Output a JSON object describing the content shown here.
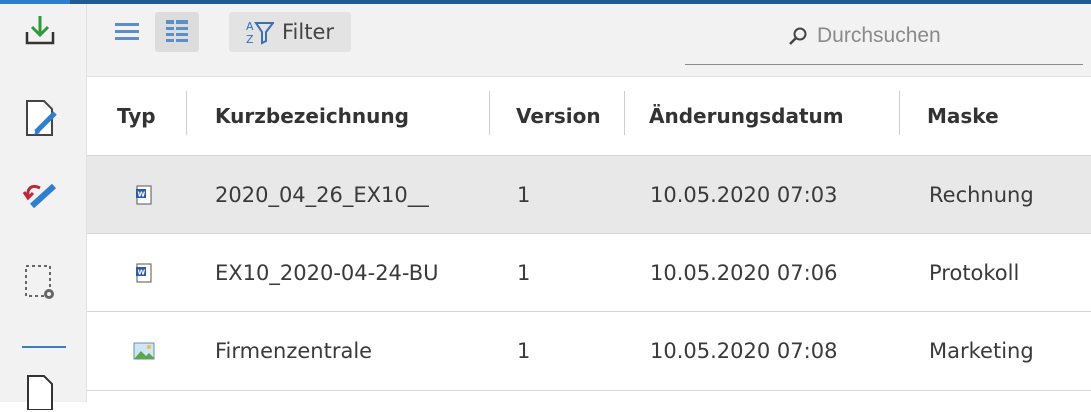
{
  "toolbar": {
    "filter_label": "Filter",
    "search_placeholder": "Durchsuchen"
  },
  "table": {
    "columns": [
      "Typ",
      "Kurzbezeichnung",
      "Version",
      "Änderungsdatum",
      "Maske"
    ],
    "rows": [
      {
        "type_icon": "word-document-icon",
        "name": "2020_04_26_EX10__",
        "version": "1",
        "date": "10.05.2020 07:03",
        "mask": "Rechnung",
        "selected": true
      },
      {
        "type_icon": "word-document-icon",
        "name": "EX10_2020-04-24-BU",
        "version": "1",
        "date": "10.05.2020 07:06",
        "mask": "Protokoll",
        "selected": false
      },
      {
        "type_icon": "image-file-icon",
        "name": "Firmenzentrale",
        "version": "1",
        "date": "10.05.2020 07:08",
        "mask": "Marketing",
        "selected": false
      }
    ]
  },
  "colors": {
    "accent": "#1d5c97",
    "rail_icon_blue": "#2f7fd0",
    "undo_red": "#c0283a",
    "download_green": "#2e9a3a"
  }
}
